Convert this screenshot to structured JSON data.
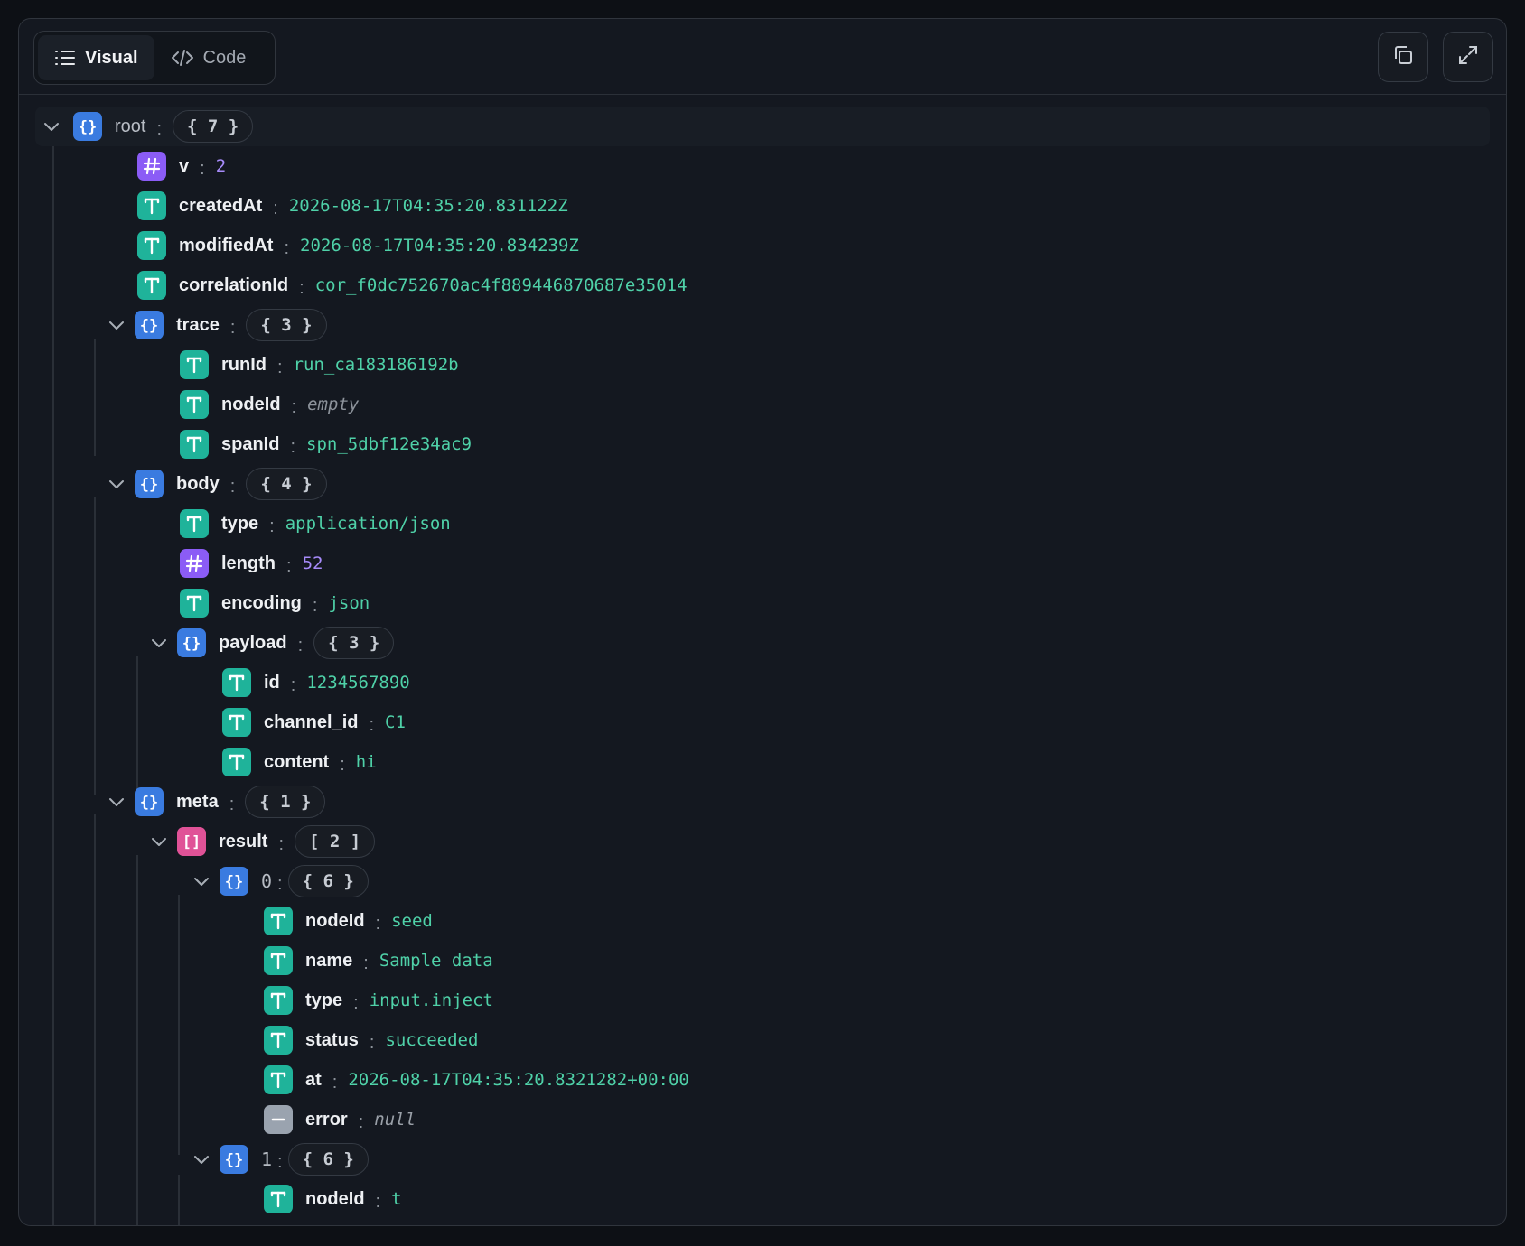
{
  "header": {
    "tabs": [
      {
        "label": "Visual",
        "icon": "list-icon",
        "active": true
      },
      {
        "label": "Code",
        "icon": "code-icon",
        "active": false
      }
    ],
    "actions": [
      "copy-icon",
      "expand-icon"
    ]
  },
  "colors": {
    "object": "#3a7be0",
    "array": "#e05297",
    "string": "#1fb39a",
    "number": "#8b5cf6",
    "null": "#9aa3af",
    "string_value": "#4fd1a8",
    "number_value": "#a78bfa"
  },
  "tree": {
    "root": {
      "key": "root",
      "count": "{ 7 }"
    },
    "v": {
      "key": "v",
      "value": "2"
    },
    "createdAt": {
      "key": "createdAt",
      "value": "2026-08-17T04:35:20.831122Z"
    },
    "modifiedAt": {
      "key": "modifiedAt",
      "value": "2026-08-17T04:35:20.834239Z"
    },
    "correlationId": {
      "key": "correlationId",
      "value": "cor_f0dc752670ac4f889446870687e35014"
    },
    "trace": {
      "key": "trace",
      "count": "{ 3 }",
      "runId": {
        "key": "runId",
        "value": "run_ca183186192b"
      },
      "nodeId": {
        "key": "nodeId",
        "value": "empty"
      },
      "spanId": {
        "key": "spanId",
        "value": "spn_5dbf12e34ac9"
      }
    },
    "body": {
      "key": "body",
      "count": "{ 4 }",
      "type": {
        "key": "type",
        "value": "application/json"
      },
      "length": {
        "key": "length",
        "value": "52"
      },
      "encoding": {
        "key": "encoding",
        "value": "json"
      },
      "payload": {
        "key": "payload",
        "count": "{ 3 }",
        "id": {
          "key": "id",
          "value": "1234567890"
        },
        "channel_id": {
          "key": "channel_id",
          "value": "C1"
        },
        "content": {
          "key": "content",
          "value": "hi"
        }
      }
    },
    "meta": {
      "key": "meta",
      "count": "{ 1 }",
      "result": {
        "key": "result",
        "count": "[ 2 ]",
        "item0": {
          "key": "0",
          "count": "{ 6 }",
          "nodeId": {
            "key": "nodeId",
            "value": "seed"
          },
          "name": {
            "key": "name",
            "value": "Sample data"
          },
          "type": {
            "key": "type",
            "value": "input.inject"
          },
          "status": {
            "key": "status",
            "value": "succeeded"
          },
          "at": {
            "key": "at",
            "value": "2026-08-17T04:35:20.8321282+00:00"
          },
          "error": {
            "key": "error",
            "value": "null"
          }
        },
        "item1": {
          "key": "1",
          "count": "{ 6 }",
          "nodeId": {
            "key": "nodeId",
            "value": "t"
          }
        }
      }
    }
  }
}
